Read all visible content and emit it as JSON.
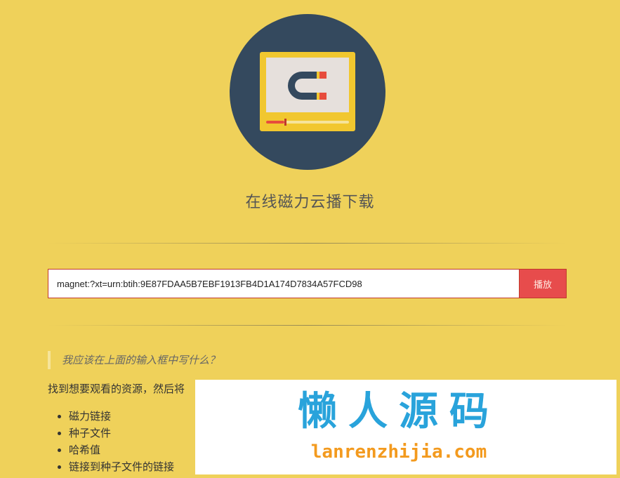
{
  "header": {
    "title": "在线磁力云播下载",
    "logo": {
      "icon": "magnet-monitor-icon",
      "progress": 0.22,
      "colors": {
        "circle": "#34495e",
        "monitor": "#f1c72f",
        "screen": "#e6e0dc",
        "magnet": "#34495e",
        "magnet_tips": "#e74c3c"
      }
    }
  },
  "search": {
    "value": "magnet:?xt=urn:btih:9E87FDAA5B7EBF1913FB4D1A174D7834A57FCD98",
    "button_label": "播放"
  },
  "faq": {
    "question": "我应该在上面的输入框中写什么？",
    "description": "找到想要观看的资源，然后将",
    "items": [
      "磁力链接",
      "种子文件",
      "哈希值",
      "链接到种子文件的链接"
    ]
  },
  "watermark": {
    "title": "懒人源码",
    "url": "lanrenzhijia.com",
    "colors": {
      "title": "#29a3db",
      "url": "#f39a1e"
    }
  },
  "theme": {
    "background": "#efd15a",
    "accent": "#e74c4c",
    "border": "#c0392b"
  }
}
